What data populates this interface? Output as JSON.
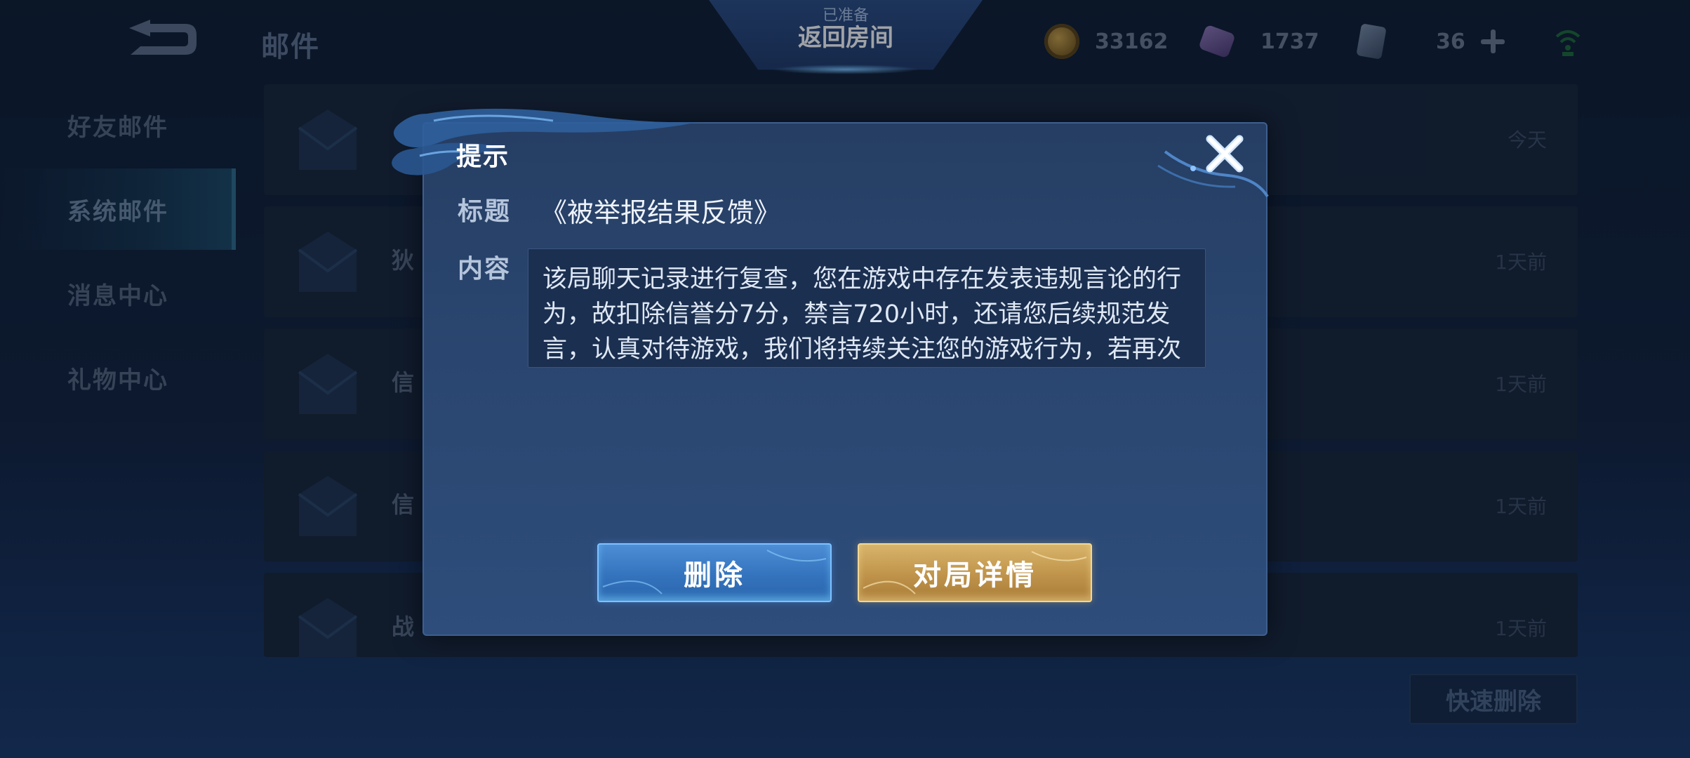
{
  "top_bar": {
    "page_title": "邮件",
    "ready_label": "已准备",
    "return_room_label": "返回房间",
    "gold_amount": "33162",
    "gem_amount": "1737",
    "ticket_amount": "36",
    "icons": [
      "back-arrow-icon",
      "gold-coin-icon",
      "gem-icon",
      "ticket-icon",
      "plus-icon",
      "wifi-icon"
    ]
  },
  "sidebar": {
    "items": [
      {
        "label": "好友邮件",
        "active": false
      },
      {
        "label": "系统邮件",
        "active": true
      },
      {
        "label": "消息中心",
        "active": false
      },
      {
        "label": "礼物中心",
        "active": false
      }
    ]
  },
  "mail_list": {
    "rows": [
      {
        "sender": "",
        "time": "今天"
      },
      {
        "sender": "狄",
        "time": "1天前"
      },
      {
        "sender": "信",
        "time": "1天前"
      },
      {
        "sender": "信",
        "time": "1天前"
      },
      {
        "sender": "战",
        "time": "1天前"
      }
    ],
    "quick_delete_label": "快速删除"
  },
  "dialog": {
    "title": "提示",
    "subject_label": "标题",
    "subject_value": "《被举报结果反馈》",
    "content_label": "内容",
    "content_text": "该局聊天记录进行复查，您在游戏中存在发表违规言论的行为，故扣除信誉分7分，禁言720小时，还请您后续规范发言，认真对待游戏，我们将持续关注您的游戏行为，若再次",
    "delete_label": "删除",
    "detail_label": "对局详情",
    "colors": {
      "delete_button": "#3473bd",
      "detail_button": "#bf934a",
      "panel": "#2a4670"
    }
  }
}
